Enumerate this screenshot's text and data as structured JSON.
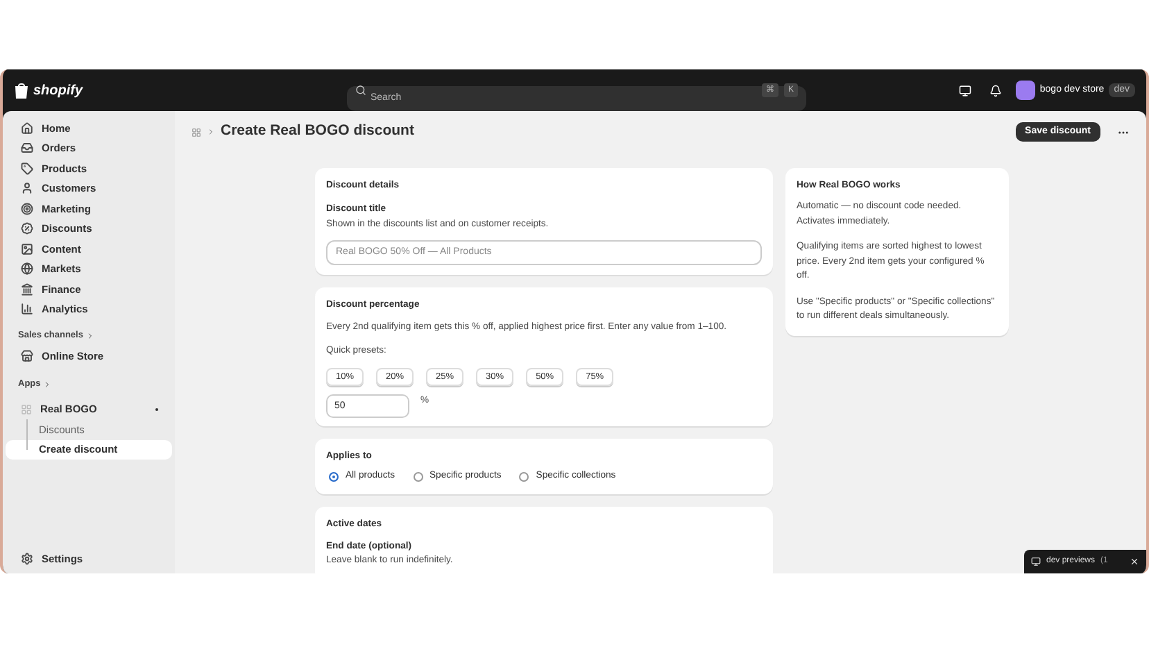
{
  "topbar": {
    "logo": "shopify",
    "search": {
      "placeholder": "Search"
    },
    "shortcut": [
      "⌘",
      "K"
    ],
    "store": "bogo dev store",
    "store_badge": "dev"
  },
  "sidebar": {
    "items": [
      {
        "label": "Home",
        "selected": false
      },
      {
        "label": "Orders",
        "selected": false
      },
      {
        "label": "Products",
        "selected": false
      },
      {
        "label": "Customers",
        "selected": false
      },
      {
        "label": "Marketing",
        "selected": false
      },
      {
        "label": "Discounts",
        "selected": false
      },
      {
        "label": "Content",
        "selected": false
      },
      {
        "label": "Markets",
        "selected": false
      },
      {
        "label": "Finance",
        "selected": false
      },
      {
        "label": "Analytics",
        "selected": false
      }
    ],
    "sales_channels": {
      "heading": "Sales channels",
      "items": [
        {
          "label": "Online Store",
          "selected": false
        }
      ]
    },
    "apps": {
      "heading": "Apps",
      "app": {
        "label": "Real BOGO",
        "selected": false,
        "children": [
          {
            "label": "Discounts",
            "selected": false
          },
          {
            "label": "Create discount",
            "selected": true
          }
        ]
      }
    },
    "settings": "Settings"
  },
  "page": {
    "title": "Create Real BOGO discount",
    "primary_action": "Save discount"
  },
  "details_card": {
    "heading": "Discount details",
    "field_label": "Discount title",
    "help": "Shown in the discounts list and on customer receipts.",
    "placeholder": "Real BOGO 50% Off — All Products"
  },
  "percentage_card": {
    "heading": "Discount percentage",
    "description": "Every 2nd qualifying item gets this % off, applied highest price first. Enter any value from 1–100.",
    "presets_label": "Quick presets:",
    "presets": [
      "10%",
      "20%",
      "25%",
      "30%",
      "50%",
      "75%"
    ],
    "value": "50",
    "suffix": "%"
  },
  "applies_card": {
    "heading": "Applies to",
    "options": [
      {
        "label": "All products",
        "selected": true
      },
      {
        "label": "Specific products",
        "selected": false
      },
      {
        "label": "Specific collections",
        "selected": false
      }
    ]
  },
  "dates_card": {
    "heading": "Active dates",
    "field_label": "End date (optional)",
    "help": "Leave blank to run indefinitely."
  },
  "info_card": {
    "heading": "How Real BOGO works",
    "paragraphs": [
      "Automatic — no discount code needed. Activates immediately.",
      "Qualifying items are sorted highest to lowest price. Every 2nd item gets your configured % off.",
      "Use \"Specific products\" or \"Specific collections\" to run different deals simultaneously."
    ]
  },
  "dev_toolbar": {
    "label": "dev previews",
    "count": "(1"
  }
}
